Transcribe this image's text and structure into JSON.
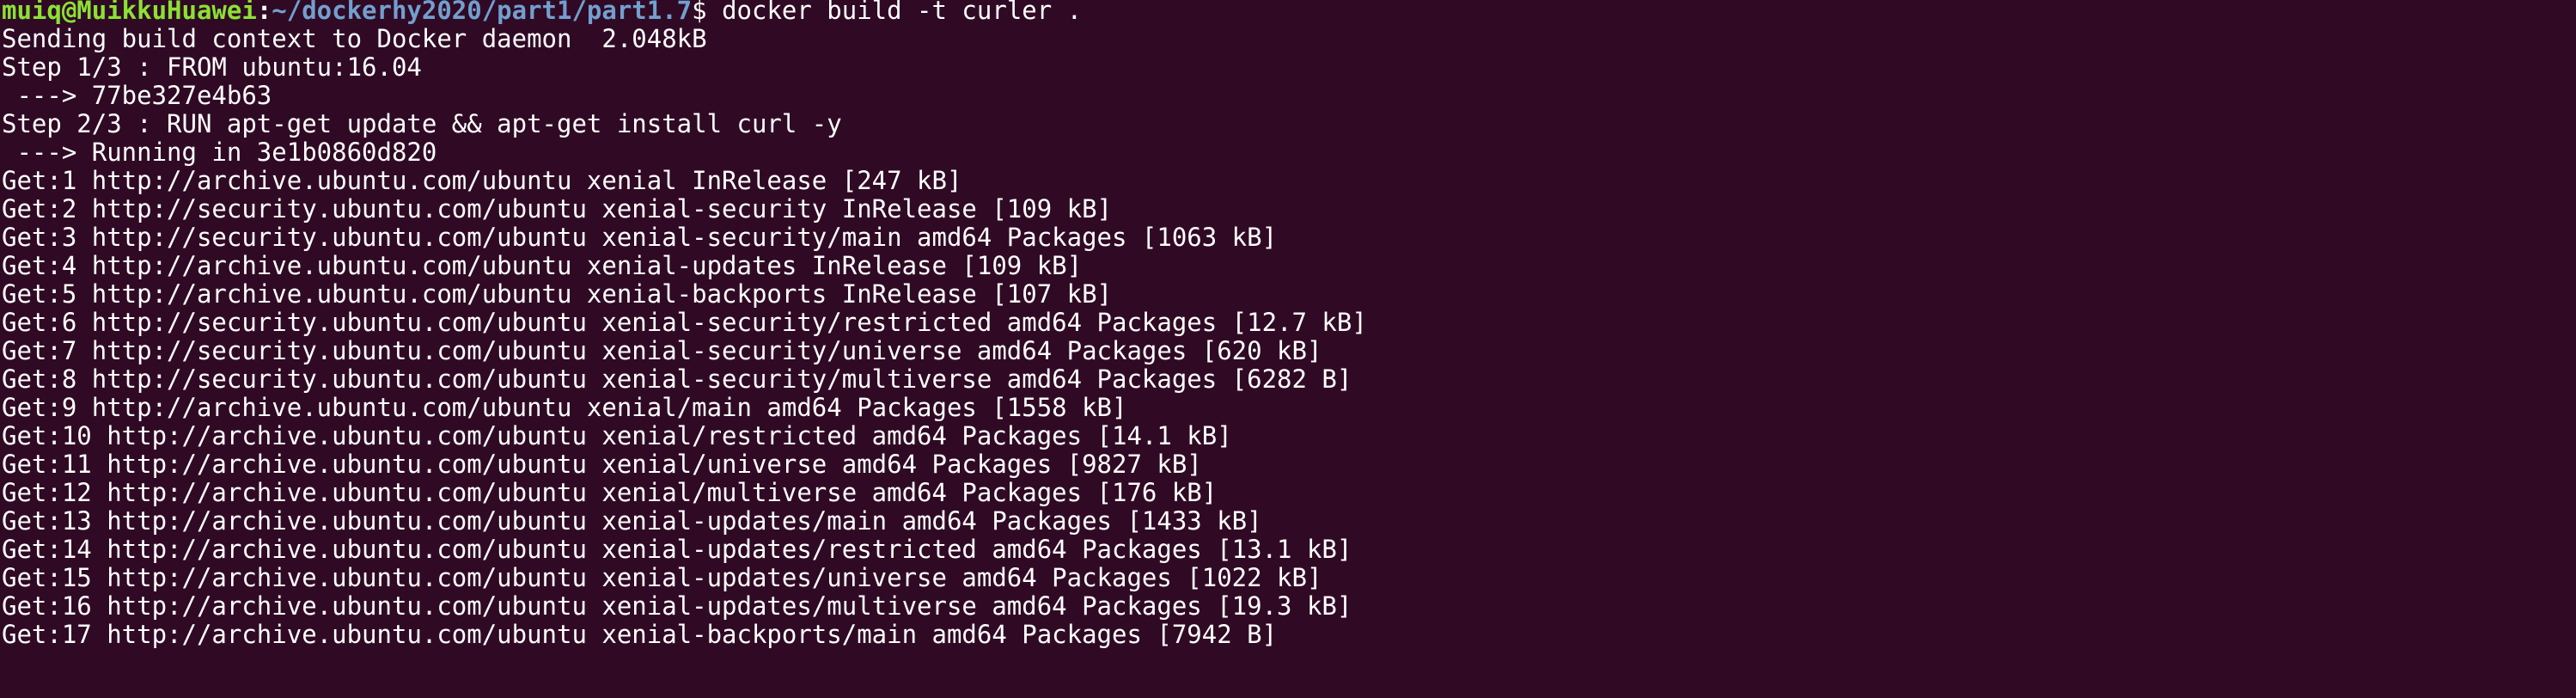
{
  "terminal": {
    "prompt": {
      "user_host": "muiq@MuikkuHuawei",
      "separator": ":",
      "path": "~/dockerhy2020/part1/part1.7",
      "symbol": "$",
      "command": " docker build -t curler ."
    },
    "output": [
      "Sending build context to Docker daemon  2.048kB",
      "Step 1/3 : FROM ubuntu:16.04",
      " ---> 77be327e4b63",
      "Step 2/3 : RUN apt-get update && apt-get install curl -y",
      " ---> Running in 3e1b0860d820",
      "Get:1 http://archive.ubuntu.com/ubuntu xenial InRelease [247 kB]",
      "Get:2 http://security.ubuntu.com/ubuntu xenial-security InRelease [109 kB]",
      "Get:3 http://security.ubuntu.com/ubuntu xenial-security/main amd64 Packages [1063 kB]",
      "Get:4 http://archive.ubuntu.com/ubuntu xenial-updates InRelease [109 kB]",
      "Get:5 http://archive.ubuntu.com/ubuntu xenial-backports InRelease [107 kB]",
      "Get:6 http://security.ubuntu.com/ubuntu xenial-security/restricted amd64 Packages [12.7 kB]",
      "Get:7 http://security.ubuntu.com/ubuntu xenial-security/universe amd64 Packages [620 kB]",
      "Get:8 http://security.ubuntu.com/ubuntu xenial-security/multiverse amd64 Packages [6282 B]",
      "Get:9 http://archive.ubuntu.com/ubuntu xenial/main amd64 Packages [1558 kB]",
      "Get:10 http://archive.ubuntu.com/ubuntu xenial/restricted amd64 Packages [14.1 kB]",
      "Get:11 http://archive.ubuntu.com/ubuntu xenial/universe amd64 Packages [9827 kB]",
      "Get:12 http://archive.ubuntu.com/ubuntu xenial/multiverse amd64 Packages [176 kB]",
      "Get:13 http://archive.ubuntu.com/ubuntu xenial-updates/main amd64 Packages [1433 kB]",
      "Get:14 http://archive.ubuntu.com/ubuntu xenial-updates/restricted amd64 Packages [13.1 kB]",
      "Get:15 http://archive.ubuntu.com/ubuntu xenial-updates/universe amd64 Packages [1022 kB]",
      "Get:16 http://archive.ubuntu.com/ubuntu xenial-updates/multiverse amd64 Packages [19.3 kB]",
      "Get:17 http://archive.ubuntu.com/ubuntu xenial-backports/main amd64 Packages [7942 B]"
    ]
  },
  "colors": {
    "background": "#300a24",
    "text": "#ffffff",
    "prompt_user": "#8ae234",
    "prompt_path": "#729fcf"
  }
}
